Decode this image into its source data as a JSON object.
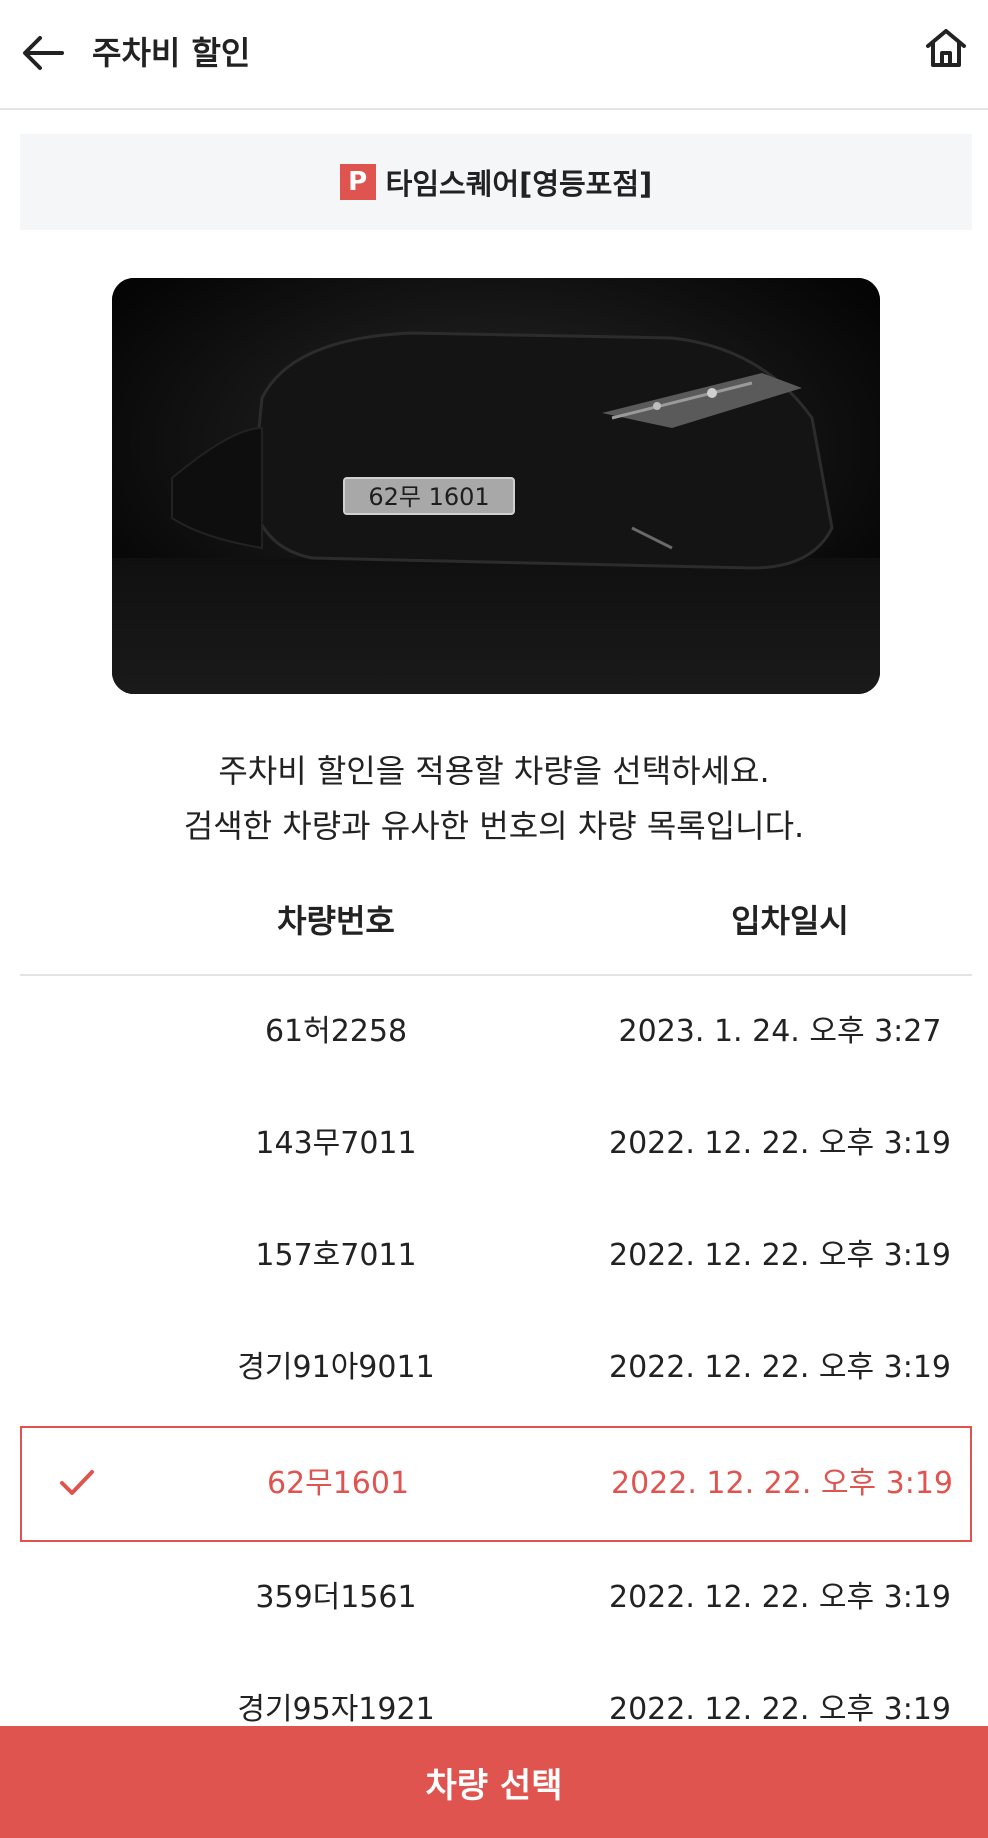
{
  "header": {
    "title": "주차비 할인",
    "back_icon": "arrow-left-icon",
    "home_icon": "home-icon"
  },
  "location": {
    "badge": "P",
    "name": "타임스퀘어[영등포점]"
  },
  "photo": {
    "plate_text": "62무 1601"
  },
  "instructions": {
    "line1": "주차비 할인을 적용할 차량을 선택하세요.",
    "line2": "검색한 차량과 유사한 번호의 차량 목록입니다."
  },
  "table": {
    "headers": {
      "plate": "차량번호",
      "time": "입차일시"
    },
    "rows": [
      {
        "plate": "61허2258",
        "time": "2023. 1. 24. 오후 3:27",
        "selected": false
      },
      {
        "plate": "143무7011",
        "time": "2022. 12. 22. 오후 3:19",
        "selected": false
      },
      {
        "plate": "157호7011",
        "time": "2022. 12. 22. 오후 3:19",
        "selected": false
      },
      {
        "plate": "경기91아9011",
        "time": "2022. 12. 22. 오후 3:19",
        "selected": false
      },
      {
        "plate": "62무1601",
        "time": "2022. 12. 22. 오후 3:19",
        "selected": true
      },
      {
        "plate": "359더1561",
        "time": "2022. 12. 22. 오후 3:19",
        "selected": false
      },
      {
        "plate": "경기95자1921",
        "time": "2022. 12. 22. 오후 3:19",
        "selected": false
      }
    ]
  },
  "footer": {
    "button_label": "차량 선택"
  },
  "colors": {
    "accent": "#e05450",
    "text": "#222222",
    "banner_bg": "#f5f6f8",
    "divider": "#e4e4e4"
  }
}
